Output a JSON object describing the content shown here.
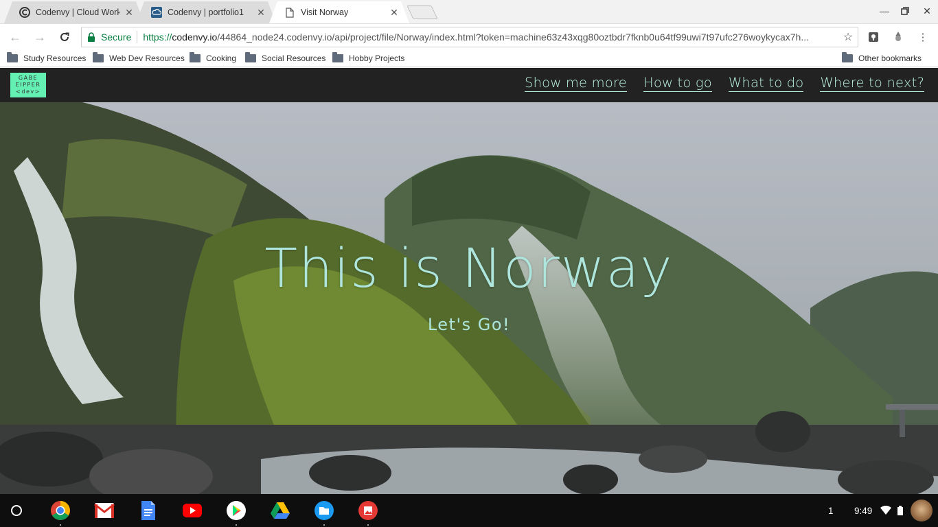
{
  "browser": {
    "tabs": [
      {
        "title": "Codenvy | Cloud Workspaces",
        "active": false
      },
      {
        "title": "Codenvy | portfolio1",
        "active": false
      },
      {
        "title": "Visit Norway",
        "active": true
      }
    ],
    "omnibox": {
      "secure_label": "Secure",
      "url_scheme": "https://",
      "url_host": "codenvy.io",
      "url_path": "/44864_node24.codenvy.io/api/project/file/Norway/index.html?token=machine63z43xqg80oztbdr7fknb0u64tf99uwi7t97ufc276woykycax7h..."
    },
    "bookmarks": [
      "Study Resources",
      "Web Dev Resources",
      "Cooking",
      "Social Resources",
      "Hobby Projects"
    ],
    "other_bookmarks": "Other bookmarks"
  },
  "site": {
    "logo": {
      "line1": "GABE",
      "line2": "EIPPER",
      "line3": "<dev>"
    },
    "nav": [
      "Show me more",
      "How to go",
      "What to do",
      "Where to next?"
    ],
    "hero_title": "This is Norway",
    "hero_subtitle": "Let's Go!"
  },
  "shelf": {
    "apps": [
      "chrome-icon",
      "gmail-icon",
      "docs-icon",
      "youtube-icon",
      "play-store-icon",
      "drive-icon",
      "files-icon",
      "gallery-icon"
    ],
    "notification_count": "1",
    "time": "9:49"
  },
  "colors": {
    "accent_mint": "#aee6dd",
    "logo_green": "#63f0b2",
    "nav_bg": "#222222",
    "secure_green": "#0b8043"
  }
}
